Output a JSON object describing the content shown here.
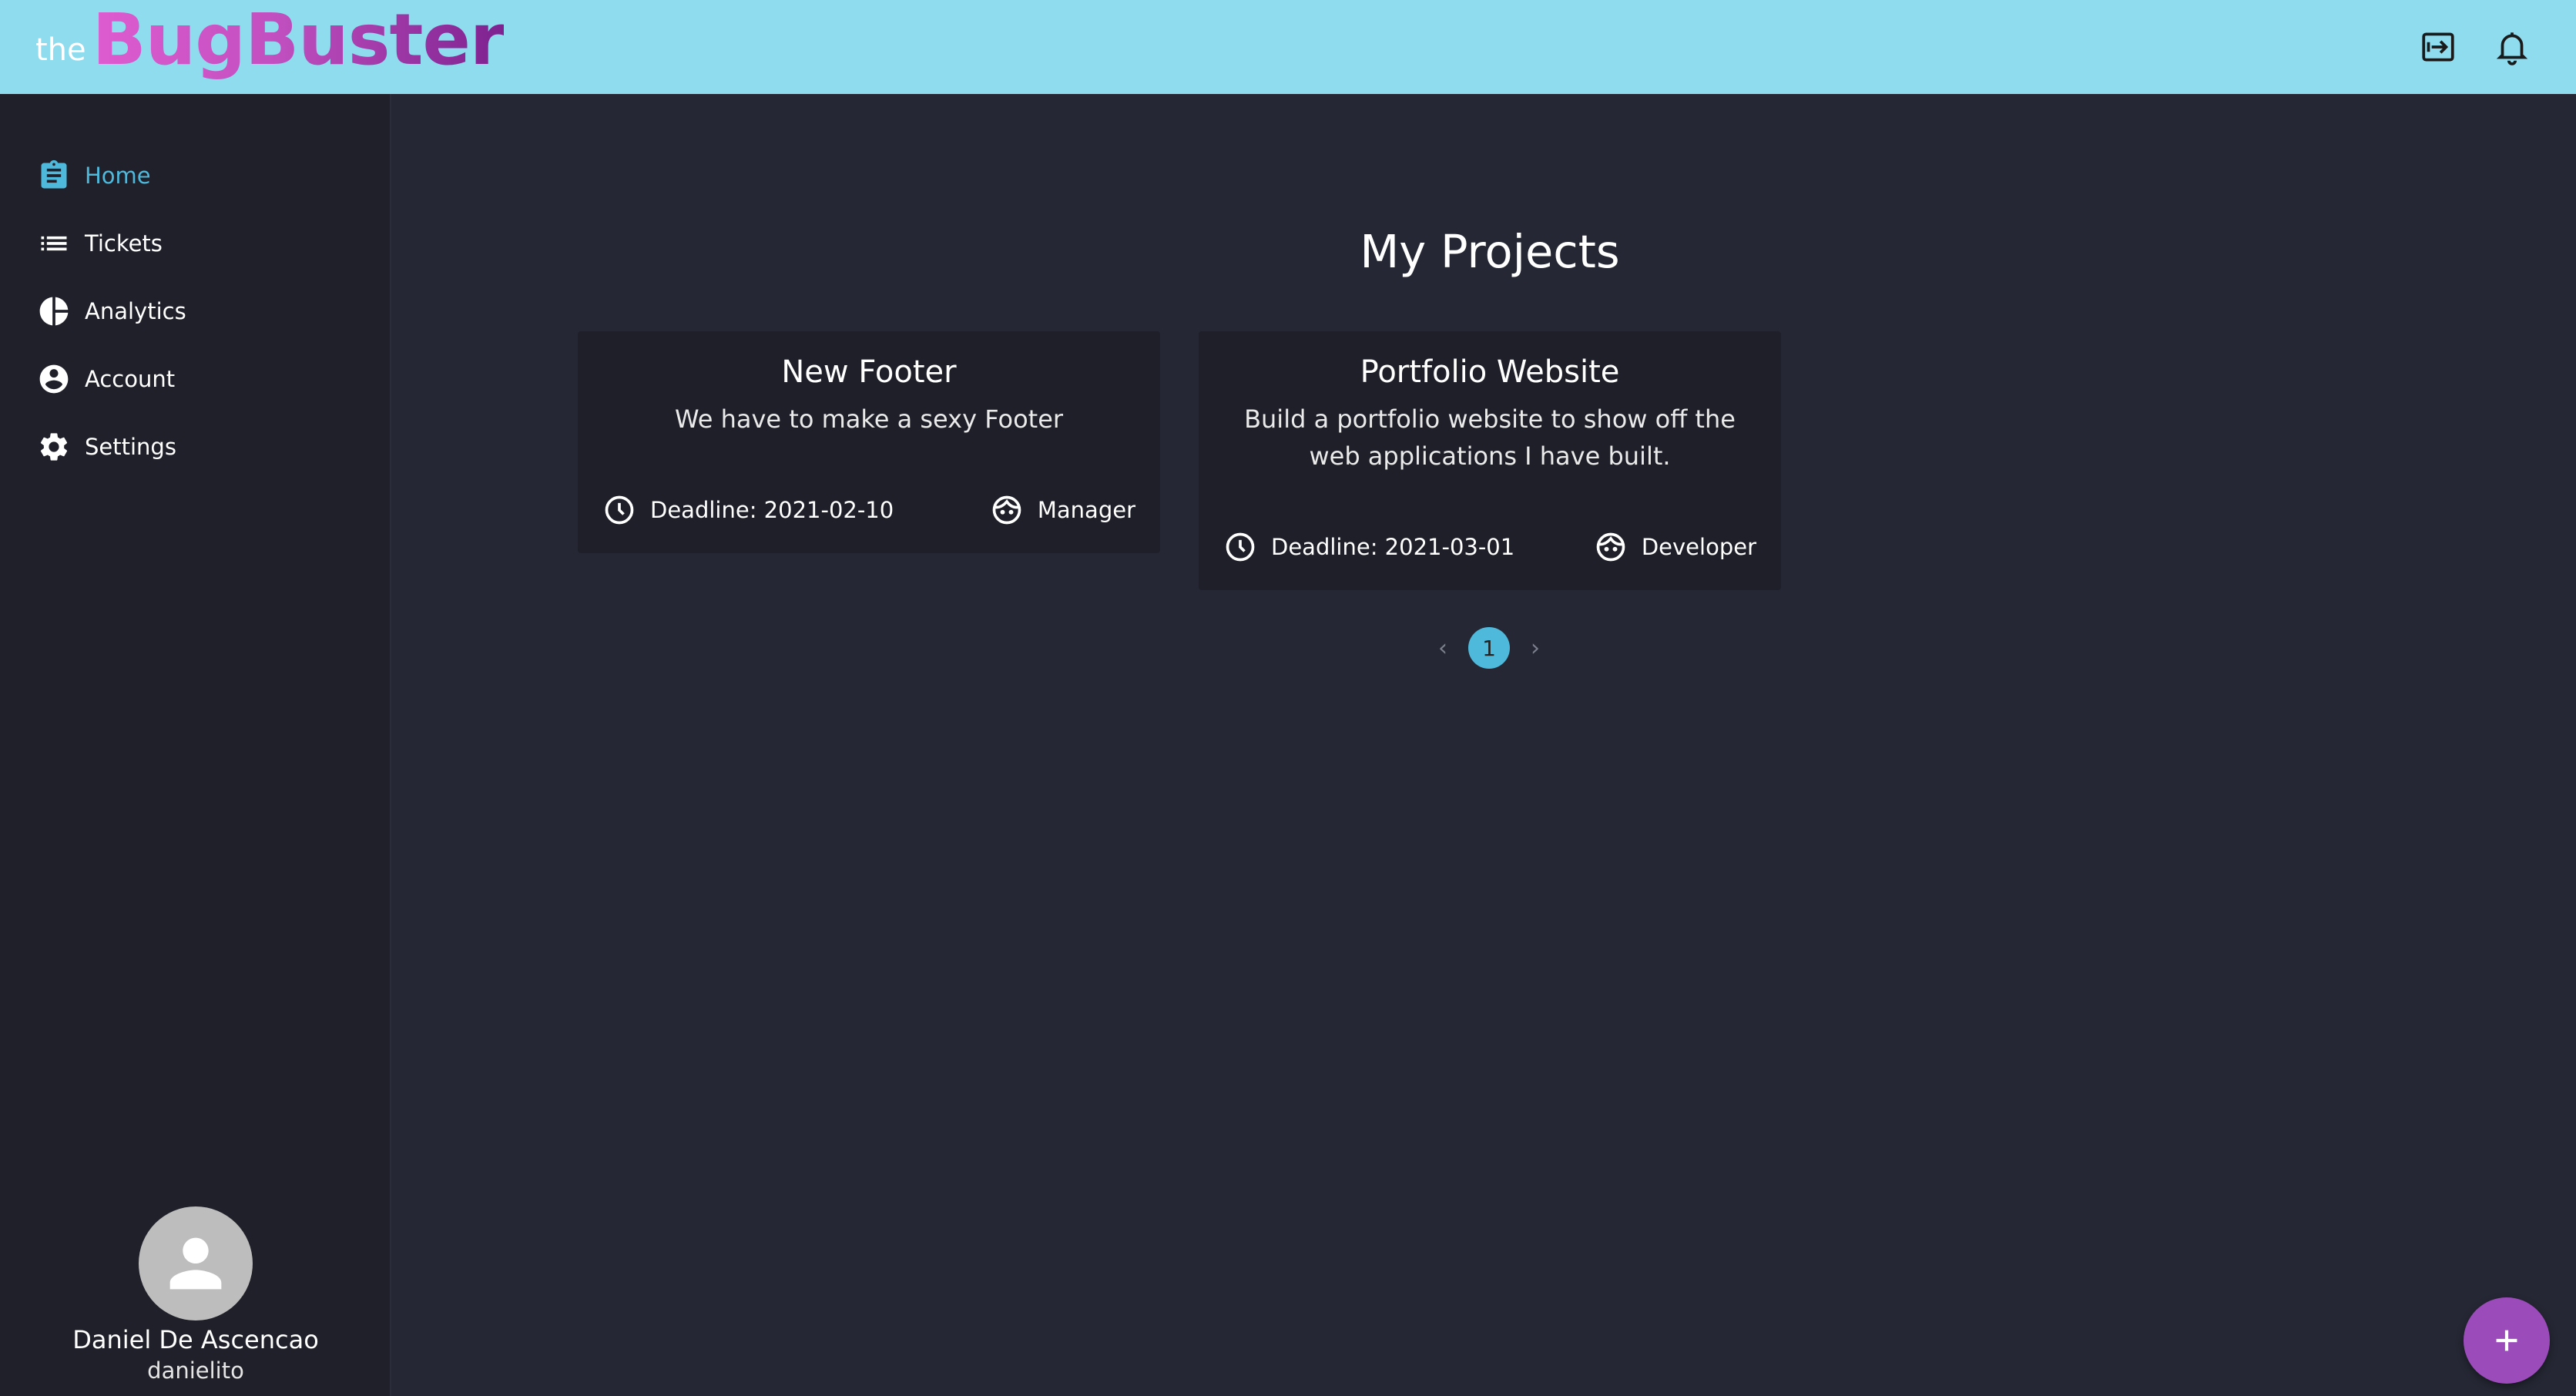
{
  "header": {
    "logo_prefix": "the",
    "logo_main": "BugBuster",
    "bg_color": "#8fdcef",
    "logout_icon": "logout-icon",
    "notification_icon": "bell-icon"
  },
  "sidebar": {
    "items": [
      {
        "label": "Home",
        "icon": "clipboard-icon",
        "active": true
      },
      {
        "label": "Tickets",
        "icon": "list-icon",
        "active": false
      },
      {
        "label": "Analytics",
        "icon": "pie-chart-icon",
        "active": false
      },
      {
        "label": "Account",
        "icon": "account-circle-icon",
        "active": false
      },
      {
        "label": "Settings",
        "icon": "gear-icon",
        "active": false
      }
    ],
    "profile": {
      "name": "Daniel De Ascencao",
      "username": "danielito"
    }
  },
  "main": {
    "title": "My Projects",
    "projects": [
      {
        "title": "New Footer",
        "description": "We have to make a sexy Footer",
        "deadline": "Deadline: 2021-02-10",
        "role": "Manager"
      },
      {
        "title": "Portfolio Website",
        "description": "Build a portfolio website to show off the web applications I have built.",
        "deadline": "Deadline: 2021-03-01",
        "role": "Developer"
      }
    ],
    "pagination": {
      "prev": "‹",
      "current": "1",
      "next": "›"
    }
  },
  "fab": {
    "label": "+",
    "icon": "plus-icon",
    "color": "#9c4bbb"
  },
  "colors": {
    "accent": "#4fb9dc",
    "background": "#252834",
    "sidebar": "#1f2029",
    "card": "#1e1f28"
  }
}
